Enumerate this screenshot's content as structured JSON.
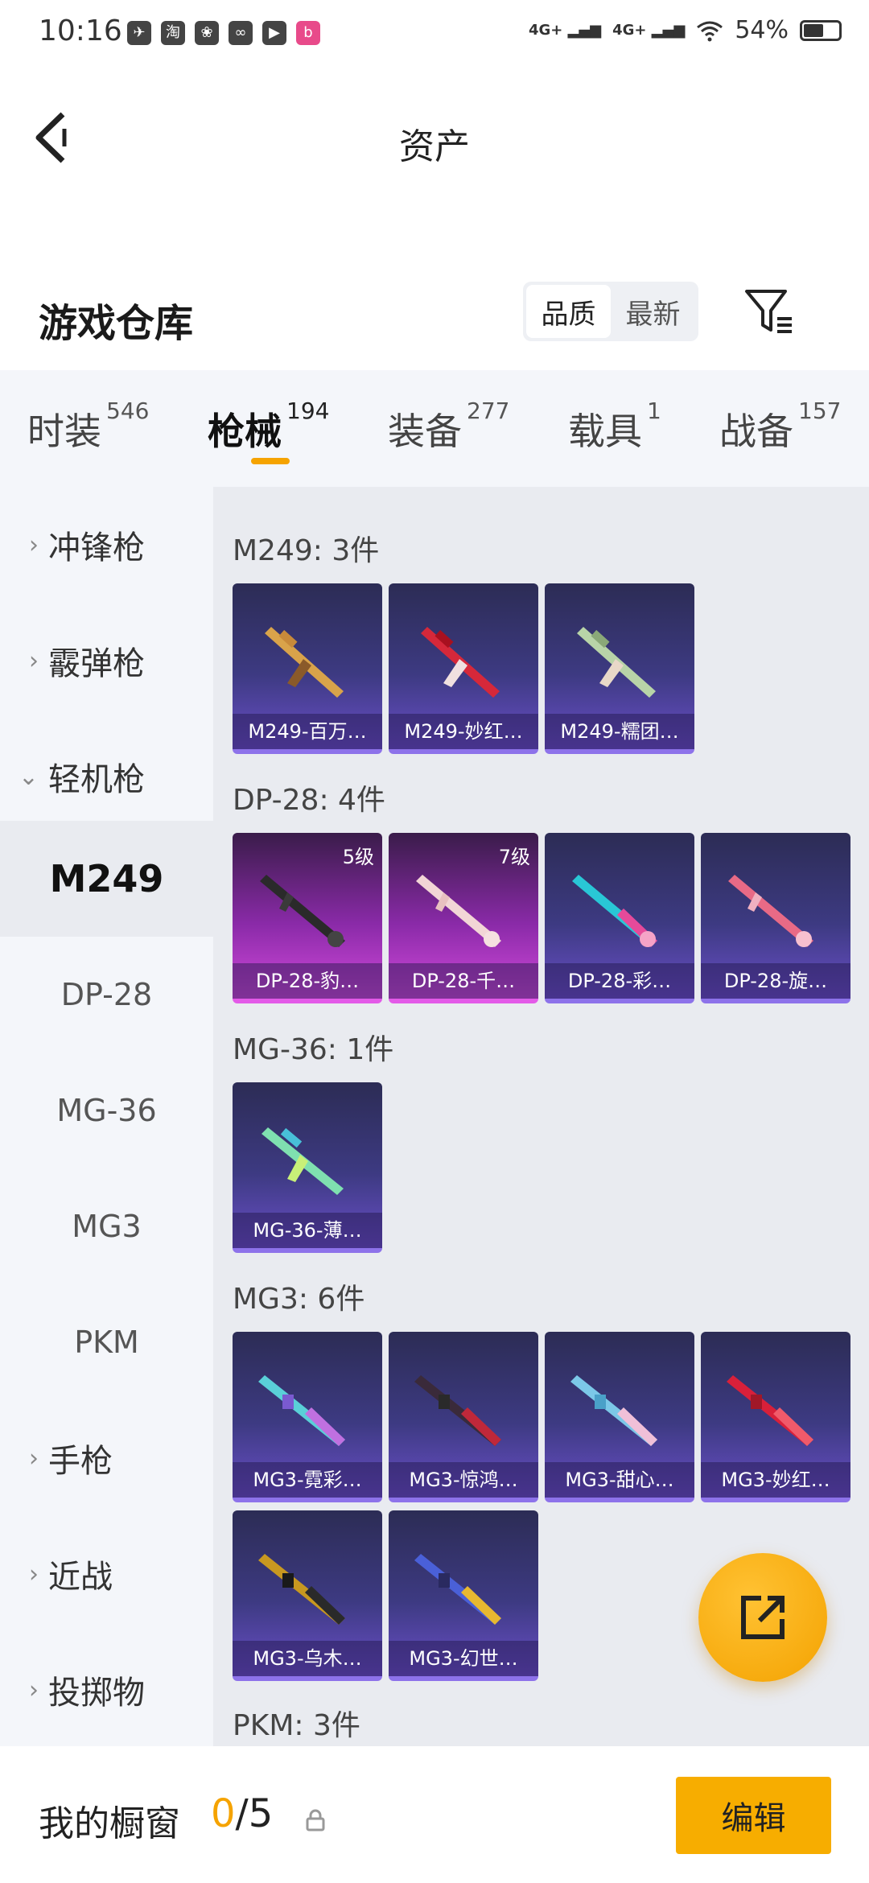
{
  "status_bar": {
    "time": "10:16",
    "net1": "4G+",
    "net2": "4G+",
    "battery": "54%"
  },
  "status_icons": [
    "bird-app-icon",
    "taobao-icon",
    "uc-icon",
    "link-icon",
    "video-icon",
    "bilibili-icon"
  ],
  "header": {
    "title": "资产"
  },
  "warehouse": {
    "title": "游戏仓库",
    "sort_quality": "品质",
    "sort_newest": "最新"
  },
  "tabs": [
    {
      "label": "时装",
      "count": "546"
    },
    {
      "label": "枪械",
      "count": "194"
    },
    {
      "label": "装备",
      "count": "277"
    },
    {
      "label": "载具",
      "count": "1"
    },
    {
      "label": "战备",
      "count": "157"
    }
  ],
  "sidebar": {
    "cat_smg": "冲锋枪",
    "cat_shotgun": "霰弹枪",
    "cat_lmg": "轻机枪",
    "sub": [
      "M249",
      "DP-28",
      "MG-36",
      "MG3",
      "PKM"
    ],
    "cat_pistol": "手枪",
    "cat_melee": "近战",
    "cat_throw": "投掷物"
  },
  "groups": [
    {
      "title": "M249: 3件",
      "items": [
        {
          "name": "M249-百万…"
        },
        {
          "name": "M249-妙红…"
        },
        {
          "name": "M249-糯团…"
        }
      ]
    },
    {
      "title": "DP-28: 4件",
      "items": [
        {
          "name": "DP-28-豹…",
          "level": "5级"
        },
        {
          "name": "DP-28-千…",
          "level": "7级"
        },
        {
          "name": "DP-28-彩…"
        },
        {
          "name": "DP-28-旋…"
        }
      ]
    },
    {
      "title": "MG-36: 1件",
      "items": [
        {
          "name": "MG-36-薄…"
        }
      ]
    },
    {
      "title": "MG3: 6件",
      "items": [
        {
          "name": "MG3-霓彩…"
        },
        {
          "name": "MG3-惊鸿…"
        },
        {
          "name": "MG3-甜心…"
        },
        {
          "name": "MG3-妙红…"
        },
        {
          "name": "MG3-乌木…"
        },
        {
          "name": "MG3-幻世…"
        }
      ]
    },
    {
      "title": "PKM: 3件",
      "items": []
    }
  ],
  "bottom": {
    "label": "我的橱窗",
    "used": "0",
    "total": "/5",
    "edit": "编辑"
  }
}
